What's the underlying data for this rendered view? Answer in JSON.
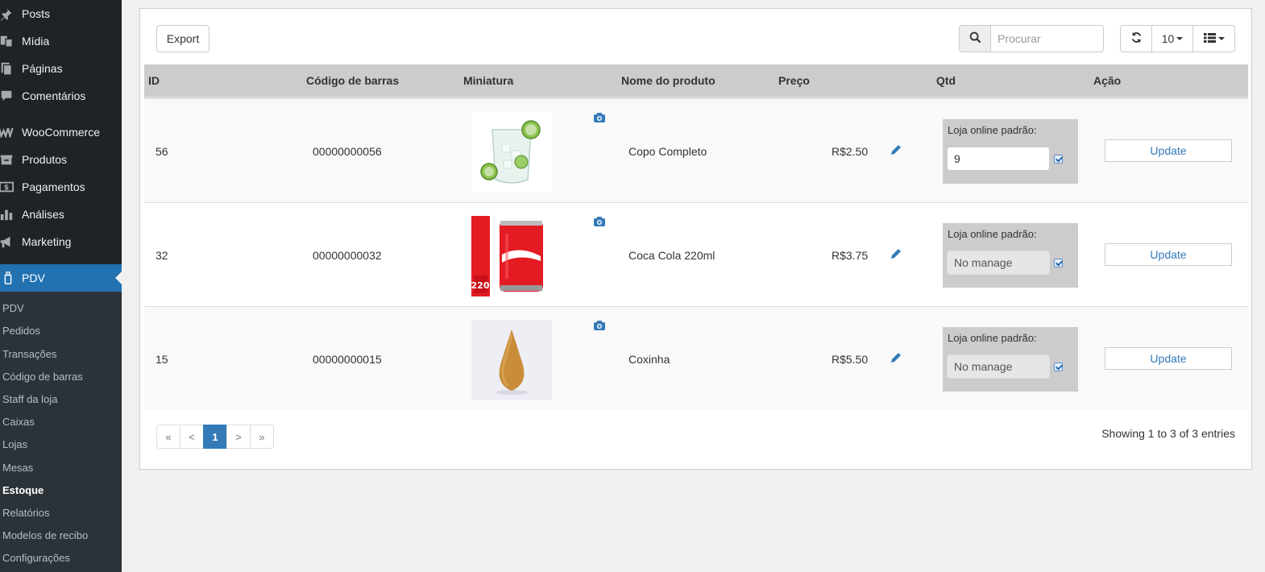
{
  "sidebar": {
    "menu": [
      {
        "label": "Posts",
        "icon": "pin-icon"
      },
      {
        "label": "Mídia",
        "icon": "media-icon"
      },
      {
        "label": "Páginas",
        "icon": "pages-icon"
      },
      {
        "label": "Comentários",
        "icon": "comments-icon"
      },
      {
        "label": "WooCommerce",
        "icon": "woocommerce-icon"
      },
      {
        "label": "Produtos",
        "icon": "products-icon"
      },
      {
        "label": "Pagamentos",
        "icon": "payments-icon"
      },
      {
        "label": "Análises",
        "icon": "analytics-icon"
      },
      {
        "label": "Marketing",
        "icon": "megaphone-icon"
      },
      {
        "label": "PDV",
        "icon": "pos-icon"
      }
    ],
    "submenu": [
      "PDV",
      "Pedidos",
      "Transações",
      "Código de barras",
      "Staff da loja",
      "Caixas",
      "Lojas",
      "Mesas",
      "Estoque",
      "Relatórios",
      "Modelos de recibo",
      "Configurações"
    ],
    "current_submenu": "Estoque"
  },
  "toolbar": {
    "export_label": "Export",
    "search_placeholder": "Procurar",
    "page_size": "10"
  },
  "table": {
    "headers": [
      "ID",
      "Código de barras",
      "Miniatura",
      "Nome do produto",
      "Preço",
      "Qtd",
      "Ação"
    ],
    "rows": [
      {
        "id": "56",
        "barcode": "00000000056",
        "name": "Copo Completo",
        "price": "R$2.50",
        "stock_label": "Loja online padrão:",
        "qty": "9",
        "qty_disabled": false,
        "action": "Update",
        "thumb": "lime-glass"
      },
      {
        "id": "32",
        "barcode": "00000000032",
        "name": "Coca Cola 220ml",
        "price": "R$3.75",
        "stock_label": "Loja online padrão:",
        "qty": "No manage",
        "qty_disabled": true,
        "action": "Update",
        "thumb": "coke-can"
      },
      {
        "id": "15",
        "barcode": "00000000015",
        "name": "Coxinha",
        "price": "R$5.50",
        "stock_label": "Loja online padrão:",
        "qty": "No manage",
        "qty_disabled": true,
        "action": "Update",
        "thumb": "coxinha"
      }
    ]
  },
  "pagination": {
    "first": "«",
    "prev": "<",
    "current": "1",
    "next": ">",
    "last": "»",
    "summary": "Showing 1 to 3 of 3 entries"
  },
  "colors": {
    "sidebar": "#1d2327",
    "active": "#2271b1",
    "link": "#337ab7",
    "header_bg": "#cccccc"
  }
}
